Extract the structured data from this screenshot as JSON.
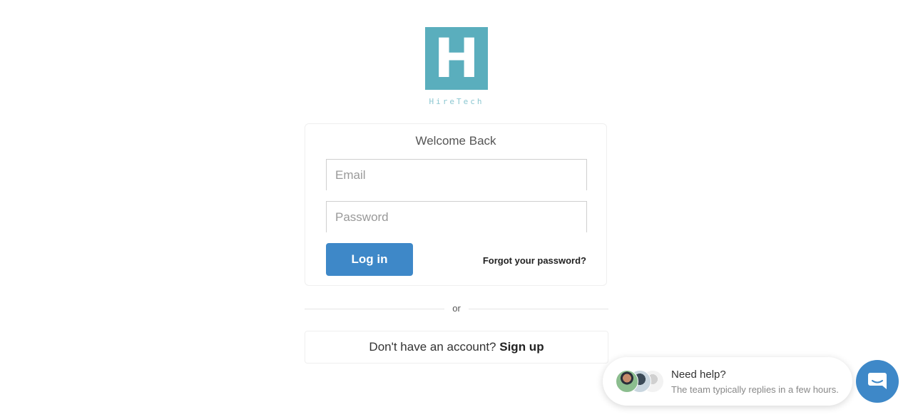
{
  "brand": {
    "logo_letter": "H",
    "name": "HireTech",
    "color": "#5aaebd"
  },
  "login": {
    "title": "Welcome Back",
    "email_placeholder": "Email",
    "email_value": "",
    "password_placeholder": "Password",
    "password_value": "",
    "login_label": "Log in",
    "forgot_label": "Forgot your password?",
    "button_color": "#3e88c8"
  },
  "divider": {
    "or_label": "or"
  },
  "signup": {
    "prompt": "Don't have an account?",
    "link_label": "Sign up"
  },
  "help_widget": {
    "title": "Need help?",
    "subtitle": "The team typically replies in a few hours.",
    "avatar_count": 3,
    "chat_icon": "chat-bubble-icon",
    "chat_color": "#3e88c8"
  }
}
